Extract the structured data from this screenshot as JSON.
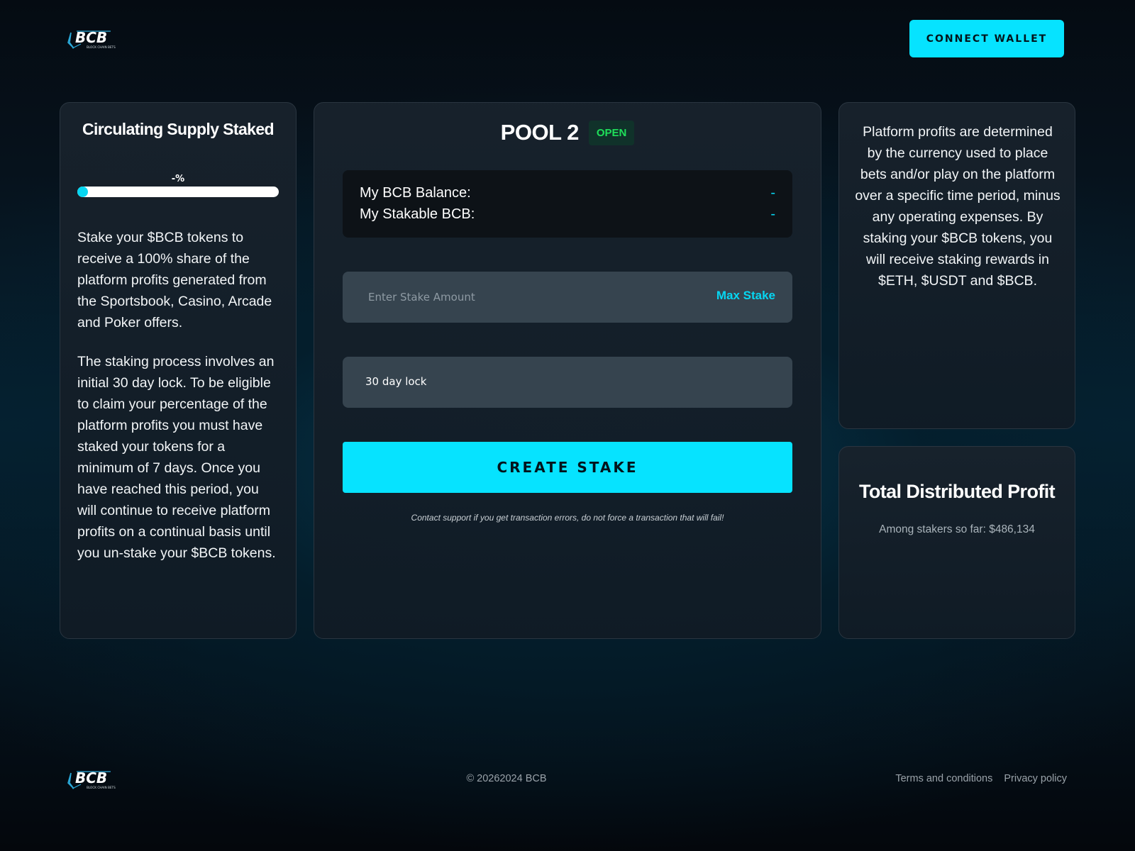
{
  "header": {
    "logo_text": "BCB",
    "logo_subtext": "BLOCK CHAIN BETS",
    "connect_wallet_label": "CONNECT WALLET"
  },
  "supply_card": {
    "title": "Circulating Supply Staked",
    "progress_label": "-%",
    "progress_value": 0,
    "paragraph_1": "Stake your $BCB tokens to receive a 100% share of the platform profits generated from the Sportsbook, Casino, Arcade and Poker offers.",
    "paragraph_2": "The staking process involves an initial 30 day lock. To be eligible to claim your percentage of the platform profits you must have staked your tokens for a minimum of 7 days. Once you have reached this period, you will continue to receive platform profits on a continual basis until you un-stake your $BCB tokens."
  },
  "pool_card": {
    "title": "POOL 2",
    "status_badge": "OPEN",
    "balance_label": "My BCB Balance:",
    "balance_value": "-",
    "stakable_label": "My Stakable BCB:",
    "stakable_value": "-",
    "stake_input": {
      "placeholder": "Enter Stake Amount",
      "value": ""
    },
    "max_stake_label": "Max Stake",
    "lock_option": "30 day lock",
    "create_stake_label": "CREATE STAKE",
    "support_note": "Contact support if you get transaction errors, do not force a transaction that will fail!"
  },
  "info_card": {
    "text": "Platform profits are determined by the currency used to place bets and/or play on the platform over a specific time period, minus any operating expenses. By staking your $BCB tokens, you will receive staking rewards in $ETH, $USDT and $BCB."
  },
  "profit_card": {
    "title": "Total Distributed Profit",
    "subtitle": "Among stakers so far: $486,134"
  },
  "footer": {
    "copyright": "© 20262024 BCB",
    "links": [
      "Terms and conditions",
      "Privacy policy"
    ]
  },
  "colors": {
    "accent": "#06e3ff",
    "open_badge_text": "#1fe05a",
    "open_badge_bg": "#10322a",
    "card_bg": "#18222c",
    "input_bg": "#36444f"
  },
  "icons": [
    "bcb-logo-icon"
  ]
}
